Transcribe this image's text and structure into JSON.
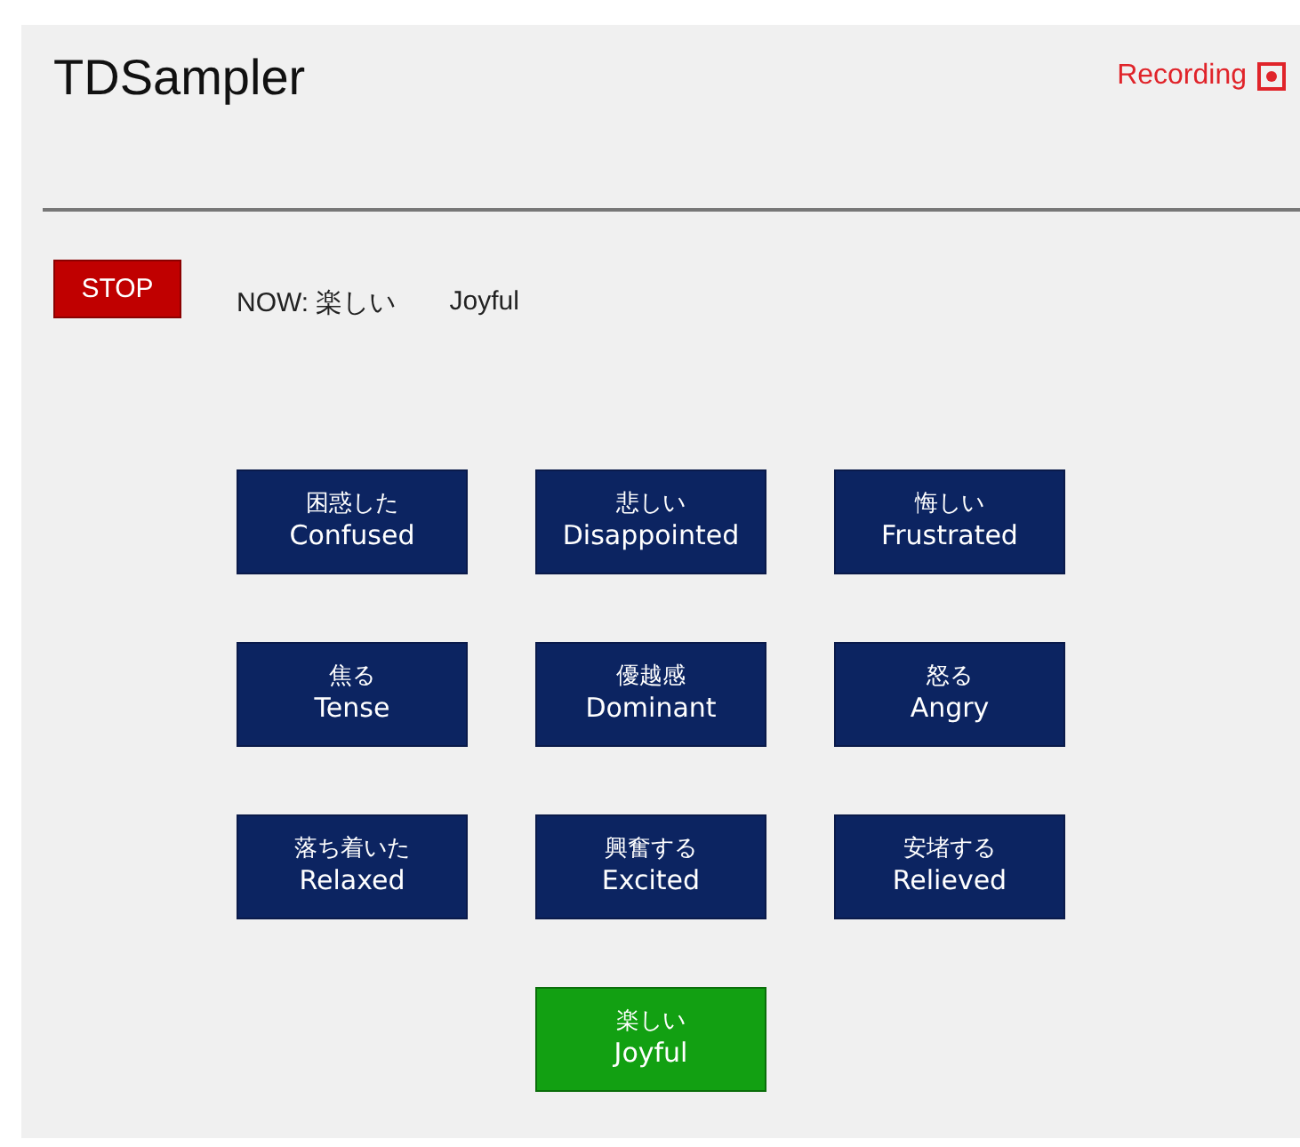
{
  "app": {
    "title": "TDSampler"
  },
  "recording": {
    "label": "Recording",
    "on": true
  },
  "stop_button": {
    "label": "STOP"
  },
  "now": {
    "label": "NOW:",
    "japanese": "楽しい",
    "english": "Joyful"
  },
  "emotions": [
    {
      "japanese": "困惑した",
      "english": "Confused",
      "selected": false
    },
    {
      "japanese": "悲しい",
      "english": "Disappointed",
      "selected": false
    },
    {
      "japanese": "悔しい",
      "english": "Frustrated",
      "selected": false
    },
    {
      "japanese": "焦る",
      "english": "Tense",
      "selected": false
    },
    {
      "japanese": "優越感",
      "english": "Dominant",
      "selected": false
    },
    {
      "japanese": "怒る",
      "english": "Angry",
      "selected": false
    },
    {
      "japanese": "落ち着いた",
      "english": "Relaxed",
      "selected": false
    },
    {
      "japanese": "興奮する",
      "english": "Excited",
      "selected": false
    },
    {
      "japanese": "安堵する",
      "english": "Relieved",
      "selected": false
    },
    {
      "japanese": "楽しい",
      "english": "Joyful",
      "selected": true
    }
  ]
}
